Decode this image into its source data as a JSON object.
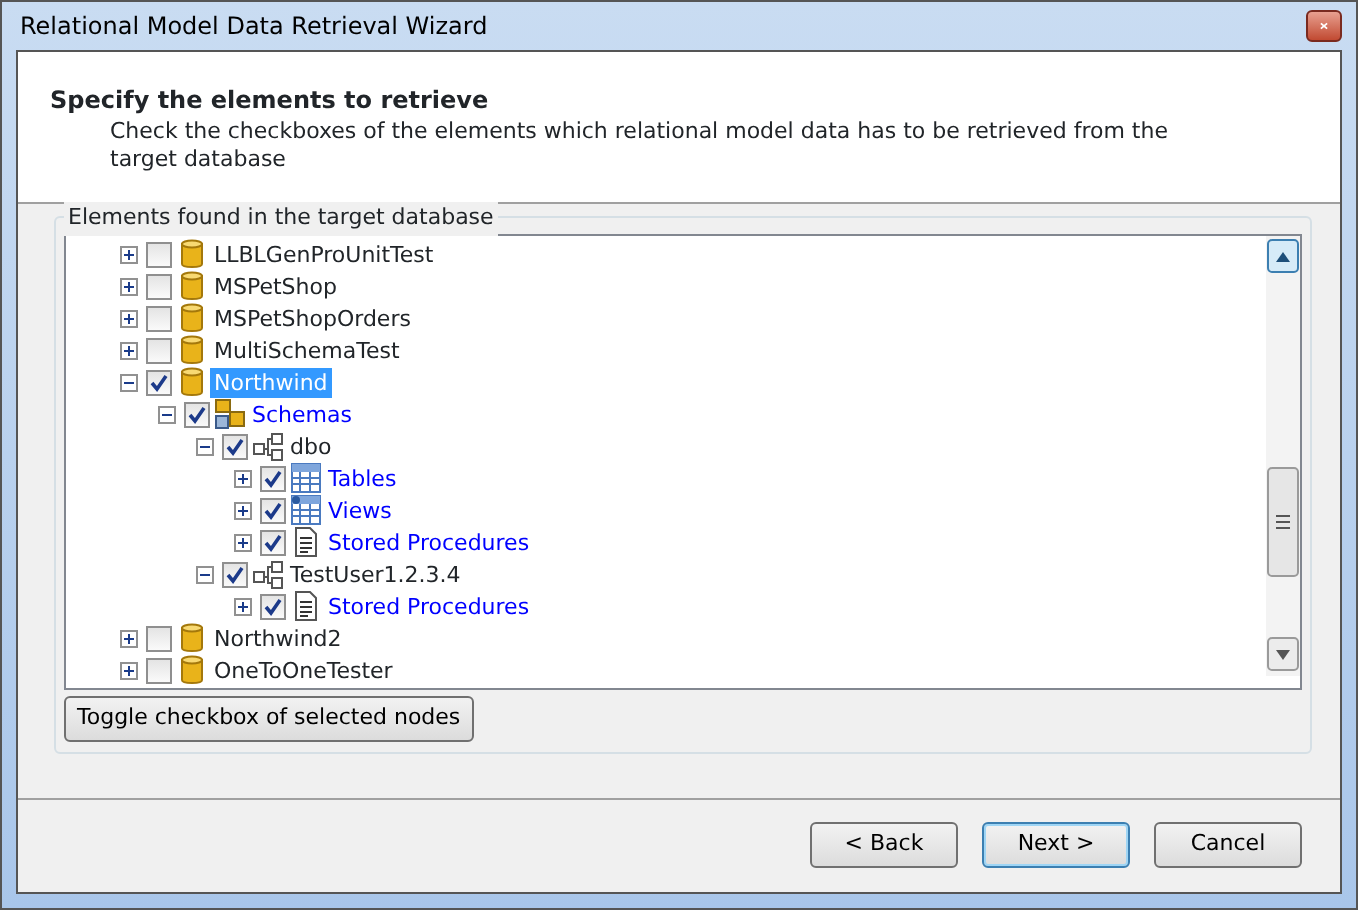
{
  "window": {
    "title": "Relational Model Data Retrieval Wizard"
  },
  "header": {
    "title": "Specify the elements to retrieve",
    "description": "Check the checkboxes of the elements which relational model data has to be retrieved from the target database"
  },
  "group": {
    "title": "Elements found in the target database"
  },
  "tree": [
    {
      "kind": "database",
      "label": "LLBLGenProUnitTest",
      "checked": false,
      "expanded": false,
      "selected": false
    },
    {
      "kind": "database",
      "label": "MSPetShop",
      "checked": false,
      "expanded": false,
      "selected": false
    },
    {
      "kind": "database",
      "label": "MSPetShopOrders",
      "checked": false,
      "expanded": false,
      "selected": false
    },
    {
      "kind": "database",
      "label": "MultiSchemaTest",
      "checked": false,
      "expanded": false,
      "selected": false
    },
    {
      "kind": "database",
      "label": "Northwind",
      "checked": true,
      "expanded": true,
      "selected": true,
      "children": [
        {
          "kind": "schemas",
          "label": "Schemas",
          "checked": true,
          "expanded": true,
          "selected": false,
          "children": [
            {
              "kind": "schema",
              "label": "dbo",
              "checked": true,
              "expanded": true,
              "selected": false,
              "children": [
                {
                  "kind": "tables",
                  "label": "Tables",
                  "checked": true,
                  "expanded": false,
                  "selected": false
                },
                {
                  "kind": "views",
                  "label": "Views",
                  "checked": true,
                  "expanded": false,
                  "selected": false
                },
                {
                  "kind": "procedures",
                  "label": "Stored Procedures",
                  "checked": true,
                  "expanded": false,
                  "selected": false
                }
              ]
            },
            {
              "kind": "schema",
              "label": "TestUser1.2.3.4",
              "checked": true,
              "expanded": true,
              "selected": false,
              "children": [
                {
                  "kind": "procedures",
                  "label": "Stored Procedures",
                  "checked": true,
                  "expanded": false,
                  "selected": false
                }
              ]
            }
          ]
        }
      ]
    },
    {
      "kind": "database",
      "label": "Northwind2",
      "checked": false,
      "expanded": false,
      "selected": false
    },
    {
      "kind": "database",
      "label": "OneToOneTester",
      "checked": false,
      "expanded": false,
      "selected": false
    }
  ],
  "toggle_button": "Toggle checkbox of selected nodes",
  "buttons": [
    {
      "label": "< Back",
      "default": false
    },
    {
      "label": "Next >",
      "default": true
    },
    {
      "label": "Cancel",
      "default": false
    }
  ]
}
